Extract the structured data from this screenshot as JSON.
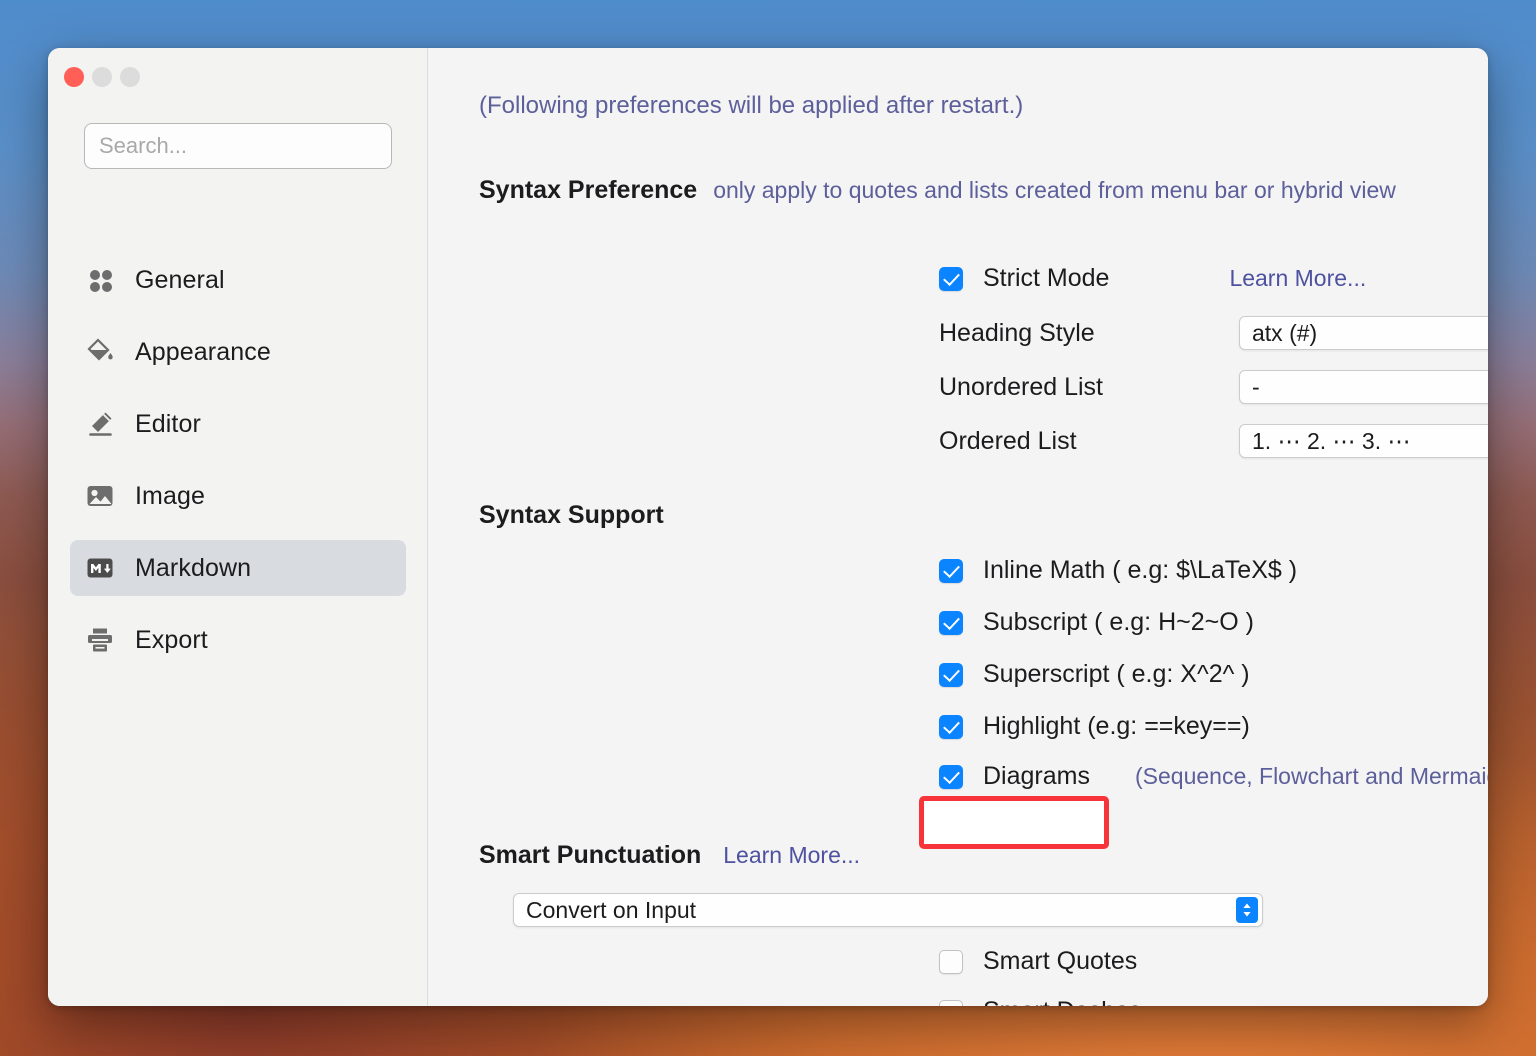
{
  "window": {
    "traffic_lights": [
      "close",
      "minimize",
      "zoom"
    ]
  },
  "sidebar": {
    "search": {
      "placeholder": "Search...",
      "value": ""
    },
    "items": [
      {
        "label": "General",
        "icon": "grid-dots-icon",
        "active": false
      },
      {
        "label": "Appearance",
        "icon": "paint-bucket-icon",
        "active": false
      },
      {
        "label": "Editor",
        "icon": "pencil-icon",
        "active": false
      },
      {
        "label": "Image",
        "icon": "image-icon",
        "active": false
      },
      {
        "label": "Markdown",
        "icon": "markdown-icon",
        "active": true
      },
      {
        "label": "Export",
        "icon": "printer-icon",
        "active": false
      }
    ]
  },
  "content": {
    "restart_note": "(Following preferences will be applied after restart.)",
    "syntax_preference": {
      "title": "Syntax Preference",
      "note": "only apply to quotes and lists created from menu bar or hybrid view",
      "strict_mode": {
        "label": "Strict Mode",
        "checked": true,
        "learn_more": "Learn More...",
        "help": "help-icon"
      },
      "fields": [
        {
          "label": "Heading Style",
          "value": "atx (#)"
        },
        {
          "label": "Unordered List",
          "value": "-"
        },
        {
          "label": "Ordered List",
          "value": "1. ⋯ 2. ⋯ 3. ⋯"
        }
      ]
    },
    "syntax_support": {
      "title": "Syntax Support",
      "options": [
        {
          "label": "Inline Math ( e.g: $\\LaTeX$ )",
          "checked": true,
          "note": ""
        },
        {
          "label": "Subscript ( e.g: H~2~O )",
          "checked": true,
          "note": ""
        },
        {
          "label": "Superscript ( e.g: X^2^ )",
          "checked": true,
          "note": ""
        },
        {
          "label": "Highlight (e.g: ==key==)",
          "checked": true,
          "note": ""
        },
        {
          "label": "Diagrams",
          "checked": true,
          "note": "(Sequence, Flowchart and Mermaid)"
        }
      ]
    },
    "smart_punctuation": {
      "title": "Smart Punctuation",
      "learn_more": "Learn More...",
      "mode": {
        "value": "Convert on Input"
      },
      "smart_quotes": {
        "label": "Smart Quotes",
        "checked": false
      },
      "smart_dashes": {
        "label": "Smart Dashes",
        "checked": false
      }
    }
  },
  "annotation": {
    "target": "Diagrams",
    "color": "#f7343a"
  },
  "colors": {
    "accent_blue": "#0a84ff",
    "link_purple": "#4e51a0",
    "note_purple": "#5c5f9a",
    "sidebar_bg": "#f3f3f2",
    "content_bg": "#f4f4f4",
    "active_row": "#d8dce1",
    "annotation_red": "#f7343a"
  }
}
